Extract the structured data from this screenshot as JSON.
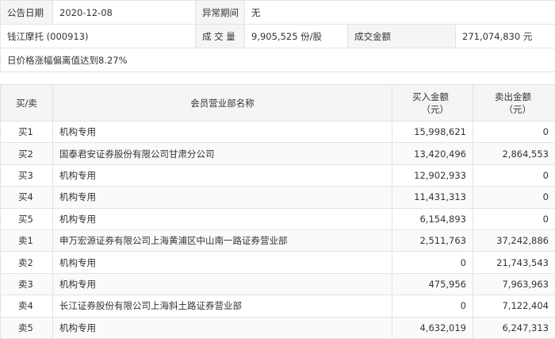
{
  "info": {
    "announce_date_label": "公告日期",
    "announce_date": "2020-12-08",
    "abnormal_period_label": "异常期间",
    "abnormal_period": "无",
    "stock": "钱江摩托 (000913)",
    "volume_label": "成 交 量",
    "volume": "9,905,525 份/股",
    "turnover_label": "成交金额",
    "turnover": "271,074,830 元",
    "reason": "日价格涨幅偏离值达到8.27%"
  },
  "table": {
    "headers": {
      "direction": "买/卖",
      "member": "会员营业部名称",
      "buy_line1": "买入金额",
      "buy_line2": "（元）",
      "sell_line1": "卖出金额",
      "sell_line2": "（元）"
    },
    "rows": [
      {
        "dir": "买1",
        "name": "机构专用",
        "buy": "15,998,621",
        "sell": "0"
      },
      {
        "dir": "买2",
        "name": "国泰君安证券股份有限公司甘肃分公司",
        "buy": "13,420,496",
        "sell": "2,864,553"
      },
      {
        "dir": "买3",
        "name": "机构专用",
        "buy": "12,902,933",
        "sell": "0"
      },
      {
        "dir": "买4",
        "name": "机构专用",
        "buy": "11,431,313",
        "sell": "0"
      },
      {
        "dir": "买5",
        "name": "机构专用",
        "buy": "6,154,893",
        "sell": "0"
      },
      {
        "dir": "卖1",
        "name": "申万宏源证券有限公司上海黄浦区中山南一路证券营业部",
        "buy": "2,511,763",
        "sell": "37,242,886"
      },
      {
        "dir": "卖2",
        "name": "机构专用",
        "buy": "0",
        "sell": "21,743,543"
      },
      {
        "dir": "卖3",
        "name": "机构专用",
        "buy": "475,956",
        "sell": "7,963,963"
      },
      {
        "dir": "卖4",
        "name": "长江证券股份有限公司上海斜土路证券营业部",
        "buy": "0",
        "sell": "7,122,404"
      },
      {
        "dir": "卖5",
        "name": "机构专用",
        "buy": "4,632,019",
        "sell": "6,247,313"
      }
    ]
  }
}
